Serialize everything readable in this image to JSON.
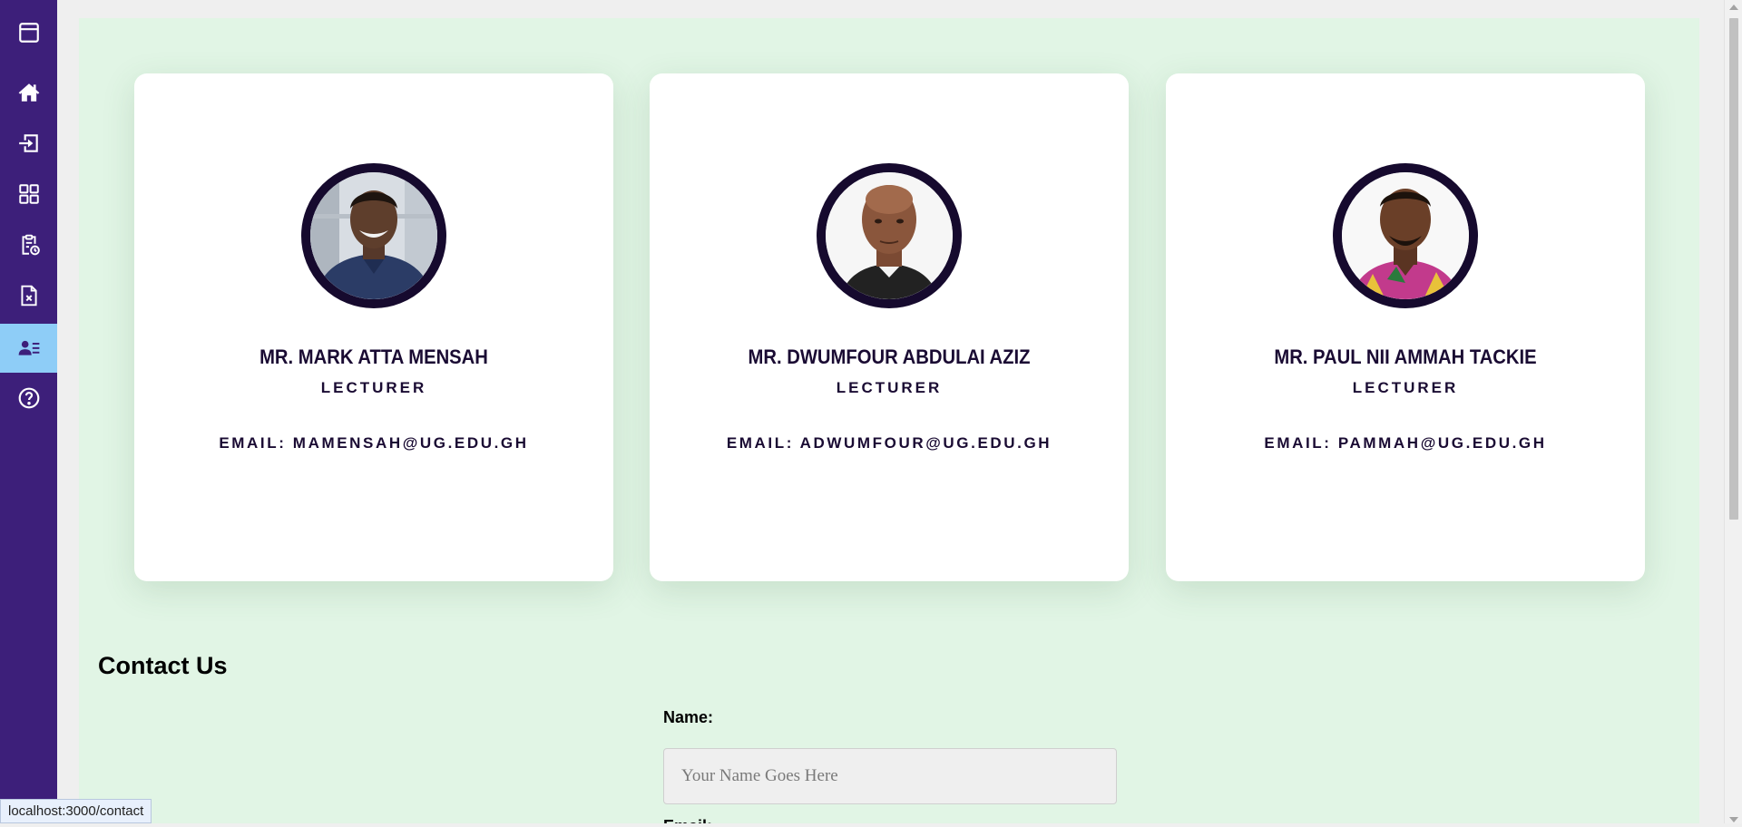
{
  "sidebar": {
    "items": [
      {
        "icon": "window-icon",
        "active": false
      },
      {
        "icon": "home-icon",
        "active": false
      },
      {
        "icon": "login-icon",
        "active": false
      },
      {
        "icon": "dashboard-grid-icon",
        "active": false
      },
      {
        "icon": "clipboard-clock-icon",
        "active": false
      },
      {
        "icon": "file-x-icon",
        "active": false
      },
      {
        "icon": "contact-card-icon",
        "active": true
      },
      {
        "icon": "help-icon",
        "active": false
      }
    ],
    "colors": {
      "background": "#3d1f7a",
      "active": "#8ecdf7",
      "icon": "#ffffff"
    }
  },
  "staff": [
    {
      "name": "MR. MARK ATTA MENSAH",
      "role": "LECTURER",
      "email": "EMAIL: MAMENSAH@UG.EDU.GH"
    },
    {
      "name": "MR. DWUMFOUR ABDULAI AZIZ",
      "role": "LECTURER",
      "email": "EMAIL: ADWUMFOUR@UG.EDU.GH"
    },
    {
      "name": "MR. PAUL NII AMMAH TACKIE",
      "role": "LECTURER",
      "email": "EMAIL: PAMMAH@UG.EDU.GH"
    }
  ],
  "contact": {
    "title": "Contact Us",
    "name_label": "Name:",
    "name_placeholder": "Your Name Goes Here",
    "email_label": "Email:"
  },
  "status_bar": {
    "url": "localhost:3000/contact"
  },
  "colors": {
    "page_background": "#e1f5e5",
    "card": "#ffffff",
    "text": "#1a0b33",
    "avatar_ring": "#160a2e"
  }
}
